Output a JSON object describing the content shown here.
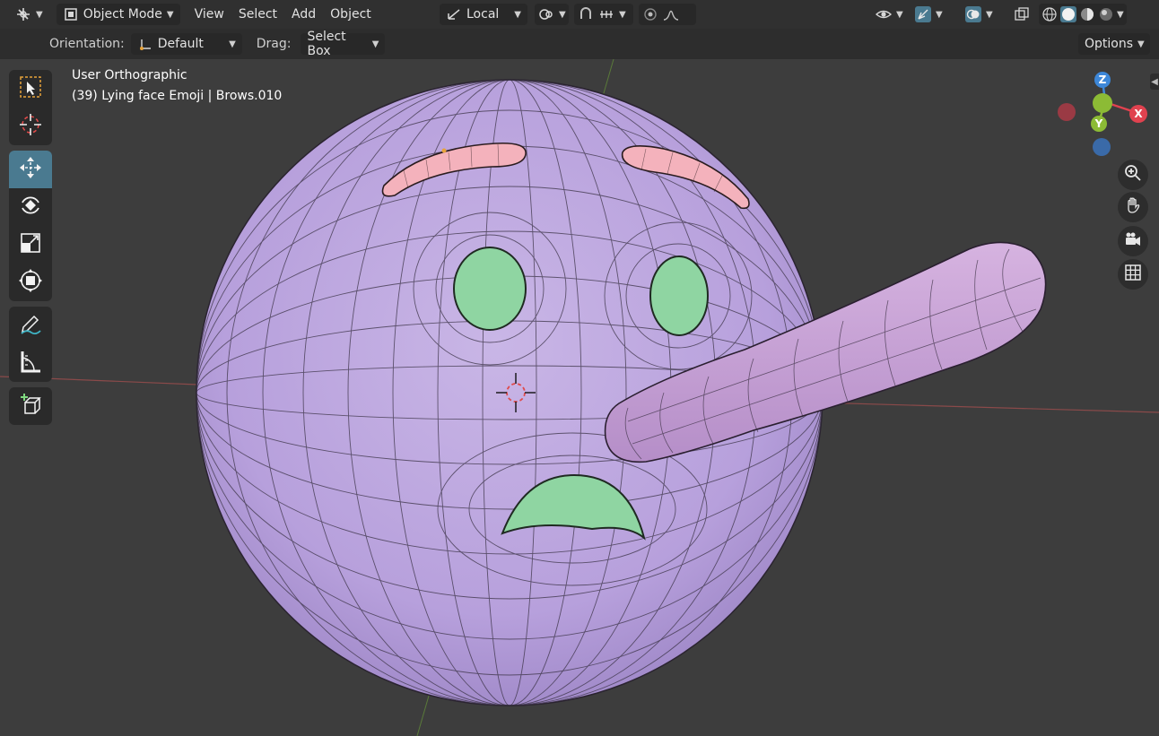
{
  "header": {
    "editor_type_icon": "editor-type-icon",
    "mode": "Object Mode",
    "menus": [
      "View",
      "Select",
      "Add",
      "Object"
    ],
    "transform_orientation": "Local",
    "icons": [
      "pivot-icon",
      "snap-icon",
      "snap-increment-icon",
      "proportional-edit-icon",
      "falloff-icon",
      "visibility-icon",
      "gizmo-icon",
      "overlay-icon",
      "xray-icon",
      "shading-wireframe-icon",
      "shading-solid-icon",
      "shading-material-icon",
      "shading-rendered-icon"
    ]
  },
  "tool_header": {
    "orientation_label": "Orientation:",
    "orientation_value": "Default",
    "drag_label": "Drag:",
    "drag_value": "Select Box",
    "options": "Options"
  },
  "viewport": {
    "view_name": "User Orthographic",
    "object_info": "(39) Lying face Emoji | Brows.010",
    "gizmo_axes": {
      "x": "X",
      "y": "Y",
      "z": "Z"
    },
    "colors": {
      "face": "#b9a3dc",
      "brows": "#f2aeb9",
      "eyes_mouth": "#8ed3a0",
      "nose": "#c8a3d6",
      "x_axis": "#e0424f",
      "y_axis": "#8cbb35",
      "z_axis": "#3d87d8",
      "active_tool": "#4a7a90"
    }
  },
  "toolbar": {
    "tools": [
      "select-box",
      "cursor",
      "move",
      "rotate",
      "scale",
      "transform",
      "annotate",
      "measure",
      "add-cube"
    ],
    "active": "move"
  },
  "nav_buttons": [
    "zoom-icon",
    "pan-hand-icon",
    "camera-icon",
    "grid-view-icon"
  ]
}
